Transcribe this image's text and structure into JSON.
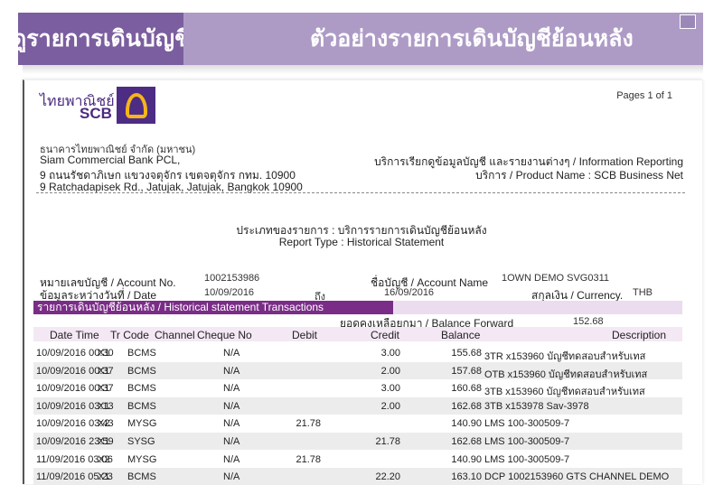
{
  "header": {
    "left_title": "ดูรายการเดินบัญชี",
    "right_title": "ตัวอย่างรายการเดินบัญชีย้อนหลัง"
  },
  "logo": {
    "thai": "ไทยพาณิชย์",
    "scb": "SCB"
  },
  "pages": "Pages 1 of 1",
  "bank": {
    "name_th": "ธนาคารไทยพาณิชย์ จำกัด (มหาชน)",
    "name_en": "Siam Commercial Bank PCL,",
    "addr_th": "9 ถนนรัชดาภิเษก แขวงจตุจักร เขตจตุจักร กทม. 10900",
    "addr_en": "9 Ratchadapisek Rd., Jatujak, Jatujak, Bangkok 10900"
  },
  "service": {
    "line1": "บริการเรียกดูข้อมูลบัญชี และรายงานต่างๆ / Information Reporting",
    "line2": "บริการ / Product Name : SCB Business Net"
  },
  "report": {
    "type_th": "ประเภทของรายการ : บริการรายการเดินบัญชีย้อนหลัง",
    "type_en": "Report Type : Historical Statement"
  },
  "account": {
    "no_label": "หมายเลขบัญชี / Account No.",
    "no": "1002153986",
    "name_label": "ชื่อบัญชี / Account Name",
    "name": "1OWN DEMO SVG0311",
    "date_label": "ข้อมูลระหว่างวันที่ / Date",
    "date_from": "10/09/2016",
    "to_label": "ถึง",
    "date_to": "16/09/2016",
    "currency_label": "สกุลเงิน / Currency.",
    "currency": "THB"
  },
  "section_title": "รายการเดินบัญชีย้อนหลัง / Historical statement Transactions",
  "balance_forward": {
    "label": "ยอดคงเหลือยกมา / Balance Forward",
    "value": "152.68"
  },
  "columns": [
    "Date Time",
    "Tr Code",
    "Channel",
    "Cheque No",
    "Debit",
    "Credit",
    "Balance",
    "Description"
  ],
  "rows": [
    [
      "10/09/2016 00:30",
      "X1",
      "BCMS",
      "N/A",
      "",
      "3.00",
      "155.68",
      "3TR x153960 บัญชีทดสอบสำหรับเทส"
    ],
    [
      "10/09/2016 00:37",
      "X1",
      "BCMS",
      "N/A",
      "",
      "2.00",
      "157.68",
      "OTB x153960 บัญชีทดสอบสำหรับเทส"
    ],
    [
      "10/09/2016 00:37",
      "X1",
      "BCMS",
      "N/A",
      "",
      "3.00",
      "160.68",
      "3TB x153960 บัญชีทดสอบสำหรับเทส"
    ],
    [
      "10/09/2016 03:13",
      "X1",
      "BCMS",
      "N/A",
      "",
      "2.00",
      "162.68",
      "3TB x153978 Sav-3978"
    ],
    [
      "10/09/2016 03:43",
      "X2",
      "MYSG",
      "N/A",
      "21.78",
      "",
      "140.90",
      "LMS 100-300509-7"
    ],
    [
      "10/09/2016 23:59",
      "X1",
      "SYSG",
      "N/A",
      "",
      "21.78",
      "162.68",
      "LMS 100-300509-7"
    ],
    [
      "11/09/2016 03:06",
      "X2",
      "MYSG",
      "N/A",
      "21.78",
      "",
      "140.90",
      "LMS 100-300509-7"
    ],
    [
      "11/09/2016 05:23",
      "X1",
      "BCMS",
      "N/A",
      "",
      "22.20",
      "163.10",
      "DCP 1002153960 GTS CHANNEL DEMO"
    ]
  ]
}
